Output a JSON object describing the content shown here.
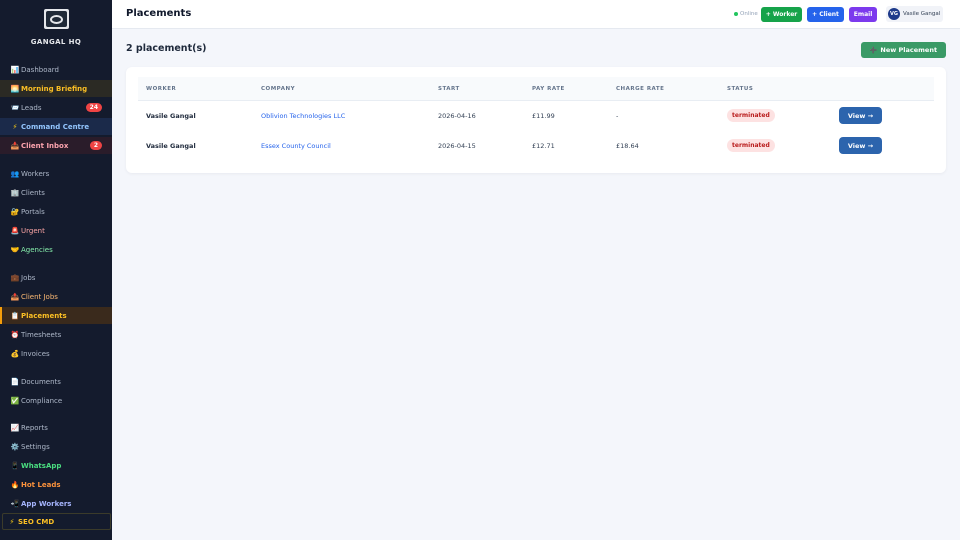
{
  "sidebar": {
    "brand": "GANGAL HQ",
    "items": [
      {
        "label": "Dashboard",
        "icon": "📊",
        "icon_name": "chart-icon"
      },
      {
        "label": "Morning Briefing",
        "icon": "🌅",
        "icon_name": "sunrise-icon"
      },
      {
        "label": "Leads",
        "icon": "📨",
        "icon_name": "envelope-icon",
        "badge": "24"
      },
      {
        "label": "Command Centre",
        "icon": "⚡",
        "icon_name": "lightning-icon"
      },
      {
        "label": "Client Inbox",
        "icon": "📥",
        "icon_name": "inbox-icon",
        "badge": "2"
      },
      {
        "label": "Workers",
        "icon": "👥",
        "icon_name": "people-icon"
      },
      {
        "label": "Clients",
        "icon": "🏢",
        "icon_name": "building-icon"
      },
      {
        "label": "Portals",
        "icon": "🔐",
        "icon_name": "lock-key-icon"
      },
      {
        "label": "Urgent",
        "icon": "🚨",
        "icon_name": "siren-icon"
      },
      {
        "label": "Agencies",
        "icon": "🤝",
        "icon_name": "handshake-icon"
      },
      {
        "label": "Jobs",
        "icon": "💼",
        "icon_name": "briefcase-icon"
      },
      {
        "label": "Client Jobs",
        "icon": "📤",
        "icon_name": "outbox-icon"
      },
      {
        "label": "Placements",
        "icon": "📋",
        "icon_name": "clipboard-icon"
      },
      {
        "label": "Timesheets",
        "icon": "⏰",
        "icon_name": "alarm-clock-icon"
      },
      {
        "label": "Invoices",
        "icon": "💰",
        "icon_name": "money-bag-icon"
      },
      {
        "label": "Documents",
        "icon": "📄",
        "icon_name": "document-icon"
      },
      {
        "label": "Compliance",
        "icon": "✅",
        "icon_name": "check-icon"
      },
      {
        "label": "Reports",
        "icon": "📈",
        "icon_name": "trend-chart-icon"
      },
      {
        "label": "Settings",
        "icon": "⚙️",
        "icon_name": "gear-icon"
      },
      {
        "label": "WhatsApp",
        "icon": "📱",
        "icon_name": "phone-icon"
      },
      {
        "label": "Hot Leads",
        "icon": "🔥",
        "icon_name": "fire-icon"
      },
      {
        "label": "App Workers",
        "icon": "📲",
        "icon_name": "mobile-arrow-icon"
      },
      {
        "label": "SEO CMD",
        "icon": "⚡",
        "icon_name": "lightning-icon"
      }
    ],
    "active": "Placements"
  },
  "header": {
    "title": "Placements",
    "status": "Online",
    "buttons": {
      "worker": "+ Worker",
      "client": "+ Client",
      "email": "Email"
    },
    "user": {
      "initials": "VG",
      "name": "Vasile Gangal"
    }
  },
  "main": {
    "count_label": "2 placement(s)",
    "new_button": "New Placement",
    "new_button_icon": "➕",
    "table": {
      "columns": [
        "WORKER",
        "COMPANY",
        "START",
        "PAY RATE",
        "CHARGE RATE",
        "STATUS"
      ],
      "rows": [
        {
          "worker": "Vasile Gangal",
          "company": "Oblivion Technologies LLC",
          "start": "2026-04-16",
          "pay_rate": "£11.99",
          "charge_rate": "-",
          "status": "terminated",
          "action": "View →"
        },
        {
          "worker": "Vasile Gangal",
          "company": "Essex County Council",
          "start": "2026-04-15",
          "pay_rate": "£12.71",
          "charge_rate": "£18.64",
          "status": "terminated",
          "action": "View →"
        }
      ]
    }
  },
  "colors": {
    "sidebar_bg": "#141b2d",
    "active_accent": "#f59e0b",
    "worker_btn": "#16a34a",
    "client_btn": "#2563eb",
    "email_btn": "#7c3aed",
    "new_btn": "#3a9a66",
    "view_btn": "#2c64ad",
    "status_terminated_bg": "#fde2e2"
  }
}
